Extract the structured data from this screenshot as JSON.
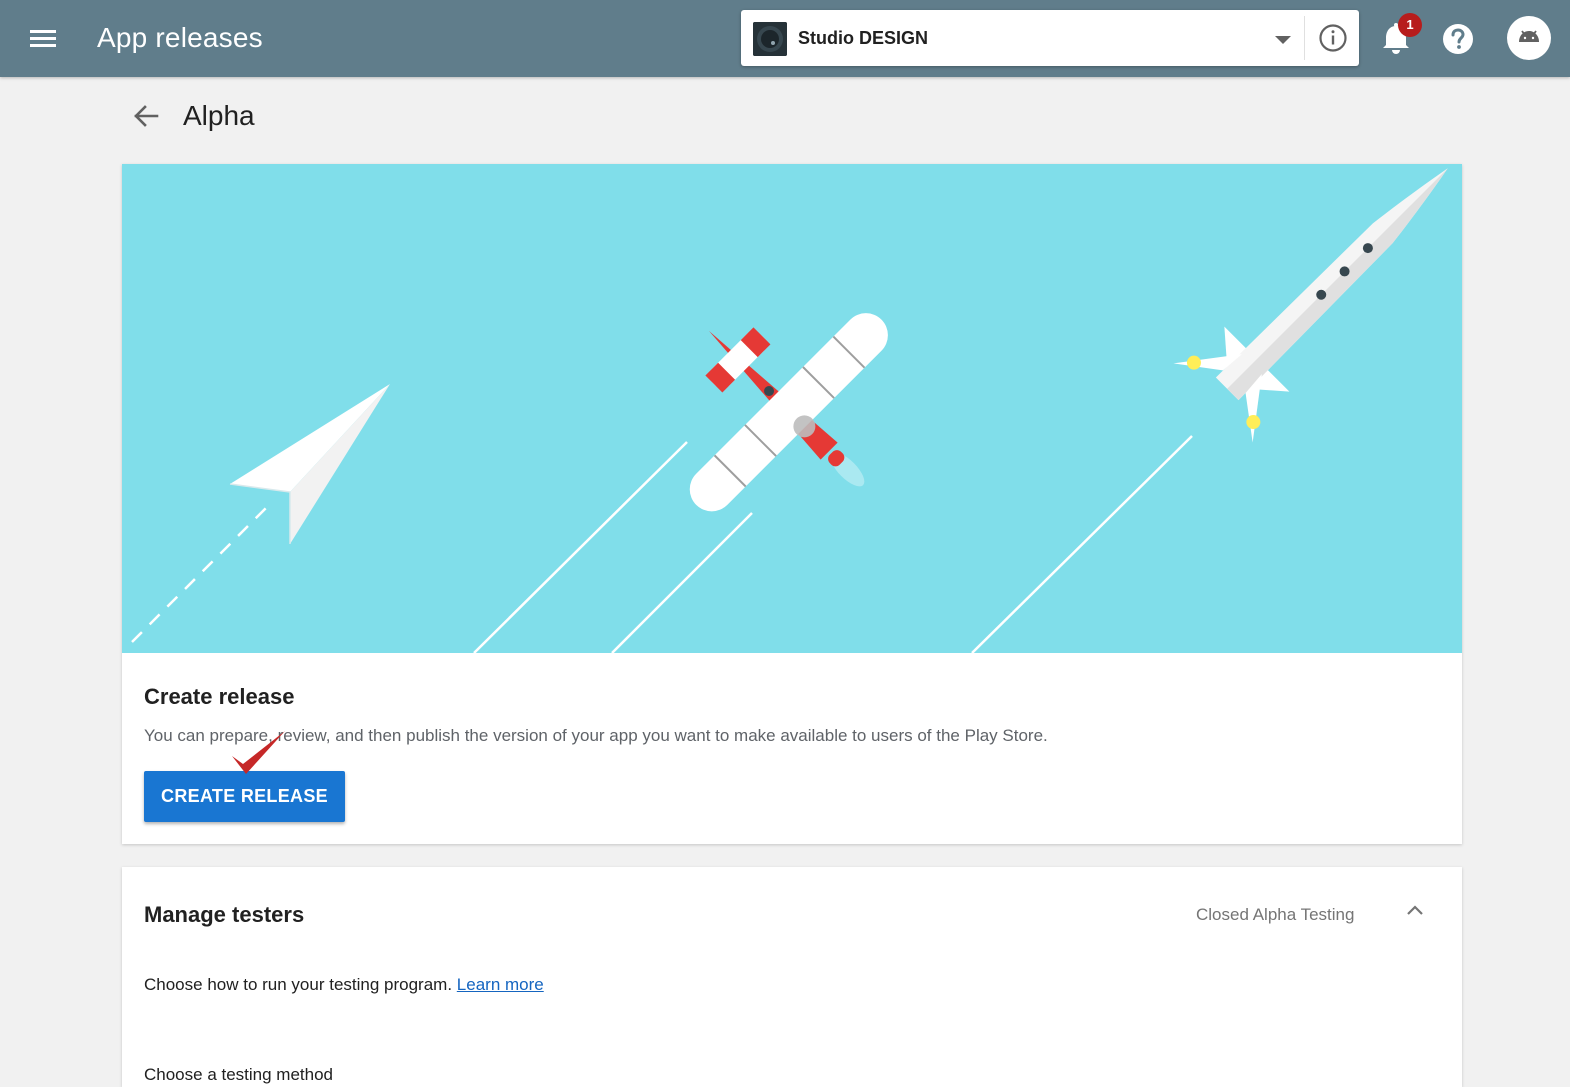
{
  "header": {
    "title": "App releases",
    "app_name": "Studio DESIGN",
    "notification_count": "1",
    "icons": [
      "menu-icon",
      "chevron-down-icon",
      "info-icon",
      "bell-icon",
      "help-icon",
      "android-avatar-icon"
    ]
  },
  "page": {
    "title": "Alpha"
  },
  "release_card": {
    "heading": "Create release",
    "description": "You can prepare, review, and then publish the version of your app you want to make available to users of the Play Store.",
    "button_label": "CREATE RELEASE",
    "illustration": [
      "paper-plane",
      "propeller-plane",
      "rocket"
    ]
  },
  "testers_card": {
    "heading": "Manage testers",
    "mode": "Closed Alpha Testing",
    "description": "Choose how to run your testing program.",
    "learn_more": "Learn more",
    "next_line": "Choose a testing method"
  },
  "colors": {
    "app_bar": "#607d8b",
    "hero_sky": "#80deea",
    "primary_button": "#1976d2",
    "badge": "#b71c1c",
    "checkmark": "#c62828",
    "link": "#1565c0"
  }
}
